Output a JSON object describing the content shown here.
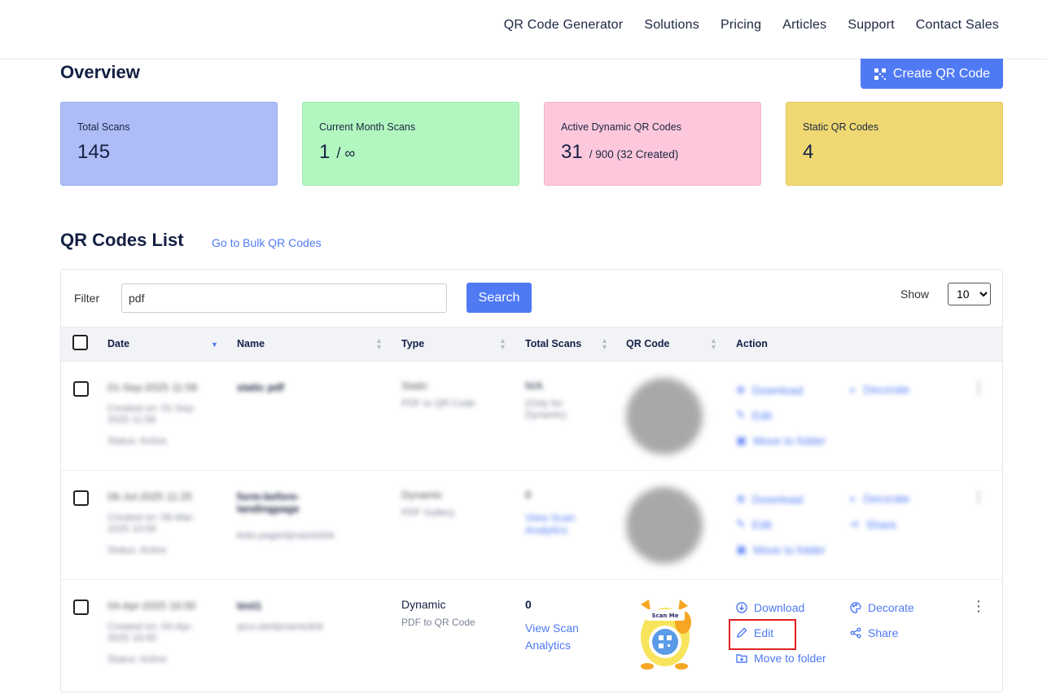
{
  "nav": {
    "items": [
      "QR Code Generator",
      "Solutions",
      "Pricing",
      "Articles",
      "Support",
      "Contact Sales"
    ]
  },
  "overview": {
    "title": "Overview",
    "create_button": "Create QR Code",
    "stats": [
      {
        "label": "Total Scans",
        "value": "145",
        "extra": ""
      },
      {
        "label": "Current Month Scans",
        "value": "1",
        "extra": "/ ∞"
      },
      {
        "label": "Active Dynamic QR Codes",
        "value": "31",
        "extra": "/ 900 (32 Created)"
      },
      {
        "label": "Static QR Codes",
        "value": "4",
        "extra": ""
      }
    ]
  },
  "list": {
    "title": "QR Codes List",
    "bulk_link": "Go to Bulk QR Codes",
    "filter_label": "Filter",
    "filter_value": "pdf",
    "search_button": "Search",
    "show_label": "Show",
    "show_value": "10",
    "columns": [
      "Date",
      "Name",
      "Type",
      "Total Scans",
      "QR Code",
      "Action"
    ],
    "rows": [
      {
        "date": "01-Sep-2025 11:58",
        "created": "Created on: 01-Sep-2025 11:58",
        "status": "Status: Active",
        "name": "static pdf",
        "sub_name": "",
        "type": "Static",
        "type_sub": "PDF to QR Code",
        "scans": "N/A",
        "scans_sub": "(Only for Dynamic)"
      },
      {
        "date": "06-Jul-2025 11:25",
        "created": "Created on: 06-Mar-2025 10:00",
        "status": "Status: Active",
        "name": "form-before-landingpage",
        "sub_name": "links.page/dynamiclink",
        "type": "Dynamic",
        "type_sub": "PDF Gallery",
        "scans": "0",
        "scans_sub": "View Scan Analytics"
      },
      {
        "date": "04-Apr-2025 16:00",
        "created": "Created on: 04-Apr-2025 16:00",
        "status": "Status: Active",
        "name": "test1",
        "sub_name": "qrco.de/dynamiclink",
        "type": "Dynamic",
        "type_sub": "PDF to QR Code",
        "scans": "0",
        "scans_sub": "View Scan Analytics",
        "mascot_text": "Scan Me"
      }
    ],
    "actions": {
      "download": "Download",
      "edit": "Edit",
      "move": "Move to folder",
      "decorate": "Decorate",
      "share": "Share"
    }
  }
}
